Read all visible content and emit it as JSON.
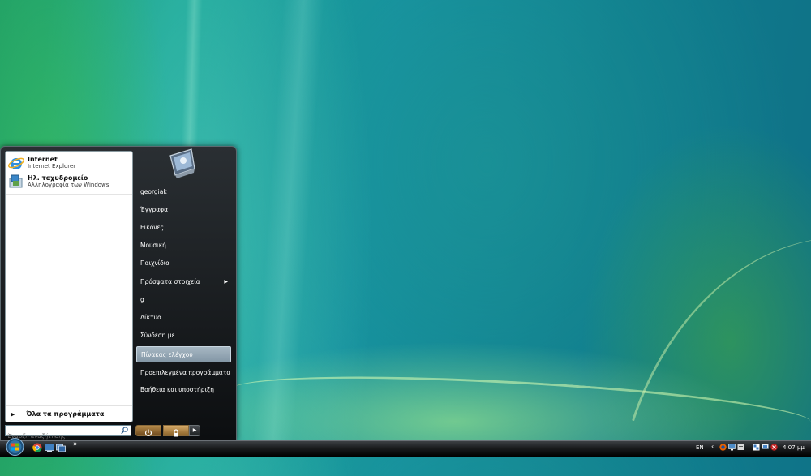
{
  "start_menu": {
    "pinned": [
      {
        "title": "Internet",
        "subtitle": "Internet Explorer",
        "icon": "internet-explorer-icon"
      },
      {
        "title": "Ηλ. ταχυδρομείο",
        "subtitle": "Αλληλογραφία των Windows",
        "icon": "windows-mail-icon"
      }
    ],
    "all_programs": "Όλα τα προγράμματα",
    "search_placeholder": "Έναρξη αναζήτησης",
    "right_items": [
      {
        "label": "georgiak"
      },
      {
        "label": "Έγγραφα"
      },
      {
        "label": "Εικόνες"
      },
      {
        "label": "Μουσική"
      },
      {
        "label": "Παιχνίδια"
      },
      {
        "label": "Πρόσφατα στοιχεία",
        "has_submenu": true
      },
      {
        "label": "g"
      },
      {
        "label": "Δίκτυο"
      },
      {
        "label": "Σύνδεση με"
      },
      {
        "label": "Πίνακας ελέγχου",
        "highlighted": true
      },
      {
        "label": "Προεπιλεγμένα προγράμματα"
      },
      {
        "label": "Βοήθεια και υποστήριξη"
      }
    ]
  },
  "taskbar": {
    "quick_launch": [
      "chrome-icon",
      "show-desktop-icon",
      "switch-windows-icon"
    ],
    "language": "EN",
    "clock": "4:07 μμ",
    "tray_icons": [
      "firefox-icon",
      "network-icon",
      "volume-icon",
      "security-icon",
      "display-icon",
      "muted-icon"
    ]
  },
  "colors": {
    "menu_bg": "#0c0e10",
    "highlight": "#8497a6",
    "desktop_accent": "#17a395"
  }
}
